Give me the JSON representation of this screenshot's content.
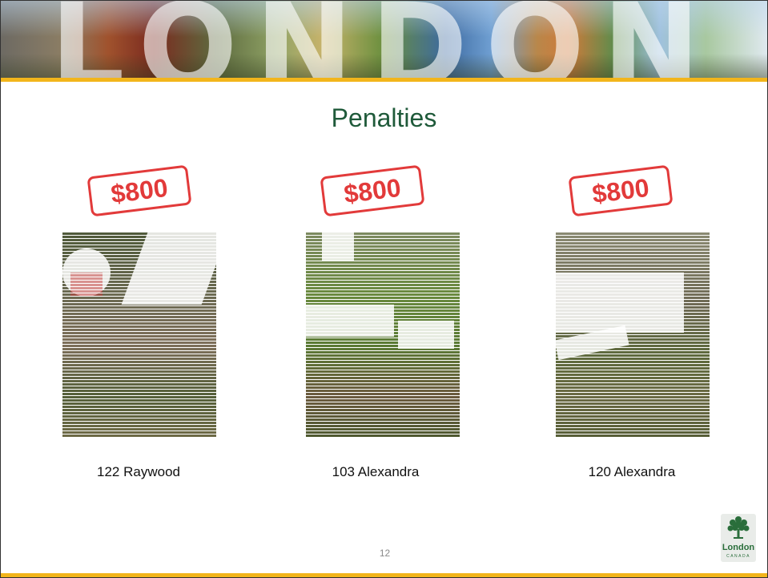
{
  "banner": {
    "word": "LONDON"
  },
  "slide": {
    "title": "Penalties",
    "page_number": "12"
  },
  "items": [
    {
      "penalty": "$800",
      "address": "122 Raywood"
    },
    {
      "penalty": "$800",
      "address": "103 Alexandra"
    },
    {
      "penalty": "$800",
      "address": "120 Alexandra"
    }
  ],
  "logo": {
    "name": "London",
    "country": "CANADA"
  },
  "colors": {
    "accent": "#f2b51b",
    "title": "#1f5a3a",
    "stamp": "#e23a3a"
  }
}
